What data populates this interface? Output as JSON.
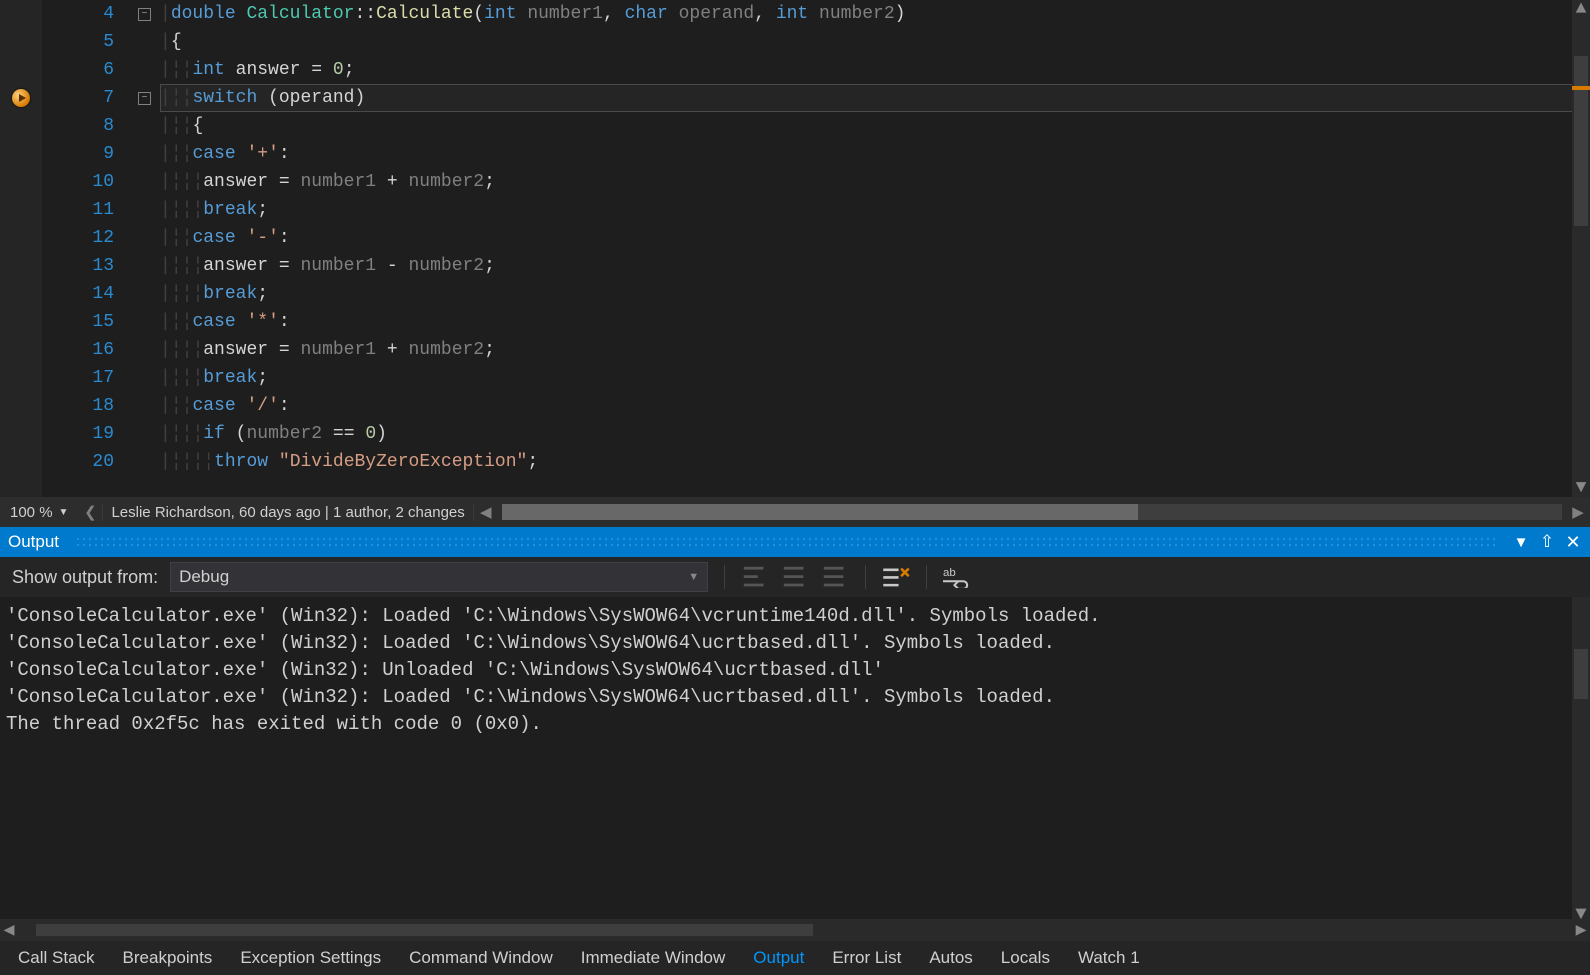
{
  "editor": {
    "lines": [
      {
        "n": 4,
        "fold": "minus",
        "tokens": [
          [
            "tok-kw",
            "double"
          ],
          [
            "tok-white",
            " "
          ],
          [
            "tok-cls",
            "Calculator"
          ],
          [
            "tok-punc",
            "::"
          ],
          [
            "tok-fn",
            "Calculate"
          ],
          [
            "tok-punc",
            "("
          ],
          [
            "tok-kw",
            "int"
          ],
          [
            "tok-white",
            " "
          ],
          [
            "tok-gray",
            "number1"
          ],
          [
            "tok-punc",
            ", "
          ],
          [
            "tok-kw",
            "char"
          ],
          [
            "tok-white",
            " "
          ],
          [
            "tok-gray",
            "operand"
          ],
          [
            "tok-punc",
            ", "
          ],
          [
            "tok-kw",
            "int"
          ],
          [
            "tok-white",
            " "
          ],
          [
            "tok-gray",
            "number2"
          ],
          [
            "tok-punc",
            ")"
          ]
        ],
        "indent": 0
      },
      {
        "n": 5,
        "tokens": [
          [
            "tok-punc",
            "{"
          ]
        ],
        "indent": 0
      },
      {
        "n": 6,
        "tokens": [
          [
            "tok-kw",
            "int"
          ],
          [
            "tok-white",
            " "
          ],
          [
            "tok-id",
            "answer = "
          ],
          [
            "tok-num",
            "0"
          ],
          [
            "tok-punc",
            ";"
          ]
        ],
        "indent": 2
      },
      {
        "n": 7,
        "current": true,
        "bp": true,
        "fold": "minus",
        "tokens": [
          [
            "tok-kw",
            "switch"
          ],
          [
            "tok-white",
            " "
          ],
          [
            "tok-punc",
            "("
          ],
          [
            "tok-id",
            "operand"
          ],
          [
            "tok-punc",
            ")"
          ]
        ],
        "indent": 2
      },
      {
        "n": 8,
        "tokens": [
          [
            "tok-punc",
            "{"
          ]
        ],
        "indent": 2
      },
      {
        "n": 9,
        "tokens": [
          [
            "tok-kw",
            "case"
          ],
          [
            "tok-white",
            " "
          ],
          [
            "tok-str",
            "'+'"
          ],
          [
            "tok-punc",
            ":"
          ]
        ],
        "indent": 2
      },
      {
        "n": 10,
        "tokens": [
          [
            "tok-id",
            "answer = "
          ],
          [
            "tok-gray",
            "number1"
          ],
          [
            "tok-id",
            " + "
          ],
          [
            "tok-gray",
            "number2"
          ],
          [
            "tok-punc",
            ";"
          ]
        ],
        "indent": 3
      },
      {
        "n": 11,
        "tokens": [
          [
            "tok-kw",
            "break"
          ],
          [
            "tok-punc",
            ";"
          ]
        ],
        "indent": 3
      },
      {
        "n": 12,
        "tokens": [
          [
            "tok-kw",
            "case"
          ],
          [
            "tok-white",
            " "
          ],
          [
            "tok-str",
            "'-'"
          ],
          [
            "tok-punc",
            ":"
          ]
        ],
        "indent": 2
      },
      {
        "n": 13,
        "tokens": [
          [
            "tok-id",
            "answer = "
          ],
          [
            "tok-gray",
            "number1"
          ],
          [
            "tok-id",
            " - "
          ],
          [
            "tok-gray",
            "number2"
          ],
          [
            "tok-punc",
            ";"
          ]
        ],
        "indent": 3
      },
      {
        "n": 14,
        "tokens": [
          [
            "tok-kw",
            "break"
          ],
          [
            "tok-punc",
            ";"
          ]
        ],
        "indent": 3
      },
      {
        "n": 15,
        "tokens": [
          [
            "tok-kw",
            "case"
          ],
          [
            "tok-white",
            " "
          ],
          [
            "tok-str",
            "'*'"
          ],
          [
            "tok-punc",
            ":"
          ]
        ],
        "indent": 2
      },
      {
        "n": 16,
        "tokens": [
          [
            "tok-id",
            "answer = "
          ],
          [
            "tok-gray",
            "number1"
          ],
          [
            "tok-id",
            " + "
          ],
          [
            "tok-gray",
            "number2"
          ],
          [
            "tok-punc",
            ";"
          ]
        ],
        "indent": 3
      },
      {
        "n": 17,
        "tokens": [
          [
            "tok-kw",
            "break"
          ],
          [
            "tok-punc",
            ";"
          ]
        ],
        "indent": 3
      },
      {
        "n": 18,
        "tokens": [
          [
            "tok-kw",
            "case"
          ],
          [
            "tok-white",
            " "
          ],
          [
            "tok-str",
            "'/'"
          ],
          [
            "tok-punc",
            ":"
          ]
        ],
        "indent": 2
      },
      {
        "n": 19,
        "tokens": [
          [
            "tok-kw",
            "if"
          ],
          [
            "tok-white",
            " "
          ],
          [
            "tok-punc",
            "("
          ],
          [
            "tok-gray",
            "number2"
          ],
          [
            "tok-id",
            " == "
          ],
          [
            "tok-num",
            "0"
          ],
          [
            "tok-punc",
            ")"
          ]
        ],
        "indent": 3
      },
      {
        "n": 20,
        "tokens": [
          [
            "tok-kw",
            "throw"
          ],
          [
            "tok-white",
            " "
          ],
          [
            "tok-str",
            "\"DivideByZeroException\""
          ],
          [
            "tok-punc",
            ";"
          ]
        ],
        "indent": 4
      }
    ],
    "footer": {
      "zoom": "100 %",
      "git": "Leslie Richardson, 60 days ago | 1 author, 2 changes"
    }
  },
  "output_panel": {
    "title": "Output",
    "label": "Show output from:",
    "source": "Debug",
    "lines": [
      "'ConsoleCalculator.exe' (Win32): Loaded 'C:\\Windows\\SysWOW64\\vcruntime140d.dll'. Symbols loaded.",
      "'ConsoleCalculator.exe' (Win32): Loaded 'C:\\Windows\\SysWOW64\\ucrtbased.dll'. Symbols loaded.",
      "'ConsoleCalculator.exe' (Win32): Unloaded 'C:\\Windows\\SysWOW64\\ucrtbased.dll'",
      "'ConsoleCalculator.exe' (Win32): Loaded 'C:\\Windows\\SysWOW64\\ucrtbased.dll'. Symbols loaded.",
      "The thread 0x2f5c has exited with code 0 (0x0)."
    ]
  },
  "tabs": {
    "items": [
      "Call Stack",
      "Breakpoints",
      "Exception Settings",
      "Command Window",
      "Immediate Window",
      "Output",
      "Error List",
      "Autos",
      "Locals",
      "Watch 1"
    ],
    "active": "Output"
  }
}
